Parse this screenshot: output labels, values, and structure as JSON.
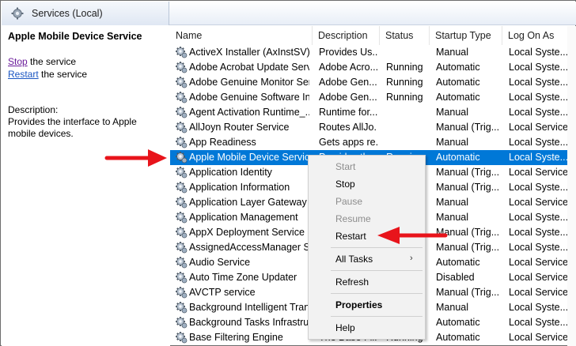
{
  "window": {
    "title": "Services (Local)"
  },
  "detail": {
    "service_name": "Apple Mobile Device Service",
    "stop_link": "Stop",
    "stop_suffix": " the service",
    "restart_link": "Restart",
    "restart_suffix": " the service",
    "description_label": "Description:",
    "description_text": "Provides the interface to Apple mobile devices."
  },
  "columns": [
    "Name",
    "Description",
    "Status",
    "Startup Type",
    "Log On As"
  ],
  "rows": [
    {
      "name": "ActiveX Installer (AxInstSV)",
      "description": "Provides Us...",
      "status": "",
      "startup": "Manual",
      "logon": "Local Syste..."
    },
    {
      "name": "Adobe Acrobat Update Serv...",
      "description": "Adobe Acro...",
      "status": "Running",
      "startup": "Automatic",
      "logon": "Local Syste..."
    },
    {
      "name": "Adobe Genuine Monitor Ser...",
      "description": "Adobe Gen...",
      "status": "Running",
      "startup": "Automatic",
      "logon": "Local Syste..."
    },
    {
      "name": "Adobe Genuine Software In...",
      "description": "Adobe Gen...",
      "status": "Running",
      "startup": "Automatic",
      "logon": "Local Syste..."
    },
    {
      "name": "Agent Activation Runtime_...",
      "description": "Runtime for...",
      "status": "",
      "startup": "Manual",
      "logon": "Local Syste..."
    },
    {
      "name": "AllJoyn Router Service",
      "description": "Routes AllJo...",
      "status": "",
      "startup": "Manual (Trig...",
      "logon": "Local Service"
    },
    {
      "name": "App Readiness",
      "description": "Gets apps re...",
      "status": "",
      "startup": "Manual",
      "logon": "Local Syste..."
    },
    {
      "name": "Apple Mobile Device Service",
      "description": "Provides th...",
      "status": "Running",
      "startup": "Automatic",
      "logon": "Local Syste..."
    },
    {
      "name": "Application Identity",
      "description": "",
      "status": "",
      "startup": "Manual (Trig...",
      "logon": "Local Service"
    },
    {
      "name": "Application Information",
      "description": "",
      "status": "",
      "startup": "Manual (Trig...",
      "logon": "Local Syste..."
    },
    {
      "name": "Application Layer Gateway ...",
      "description": "",
      "status": "",
      "startup": "Manual",
      "logon": "Local Service"
    },
    {
      "name": "Application Management",
      "description": "",
      "status": "",
      "startup": "Manual",
      "logon": "Local Syste..."
    },
    {
      "name": "AppX Deployment Service (...",
      "description": "",
      "status": "",
      "startup": "Manual (Trig...",
      "logon": "Local Syste..."
    },
    {
      "name": "AssignedAccessManager Se...",
      "description": "",
      "status": "",
      "startup": "Manual (Trig...",
      "logon": "Local Syste..."
    },
    {
      "name": "Audio Service",
      "description": "",
      "status": "",
      "startup": "Automatic",
      "logon": "Local Service"
    },
    {
      "name": "Auto Time Zone Updater",
      "description": "",
      "status": "",
      "startup": "Disabled",
      "logon": "Local Service"
    },
    {
      "name": "AVCTP service",
      "description": "",
      "status": "",
      "startup": "Manual (Trig...",
      "logon": "Local Service"
    },
    {
      "name": "Background Intelligent Tran...",
      "description": "",
      "status": "",
      "startup": "Manual",
      "logon": "Local Syste..."
    },
    {
      "name": "Background Tasks Infrastruc...",
      "description": "",
      "status": "",
      "startup": "Automatic",
      "logon": "Local Syste..."
    },
    {
      "name": "Base Filtering Engine",
      "description": "The Base Fil...",
      "status": "Running",
      "startup": "Automatic",
      "logon": "Local Service"
    }
  ],
  "selected_index": 7,
  "context_menu": {
    "start": "Start",
    "stop": "Stop",
    "pause": "Pause",
    "resume": "Resume",
    "restart": "Restart",
    "all_tasks": "All Tasks",
    "refresh": "Refresh",
    "properties": "Properties",
    "help": "Help"
  },
  "colors": {
    "selection": "#0078d7",
    "annotation_arrow": "#e8141b",
    "link": "#1a55c2"
  },
  "icons": {
    "service": "gear-icon",
    "submenu": "chevron-right-icon",
    "annotation": "red-arrow-icon"
  }
}
